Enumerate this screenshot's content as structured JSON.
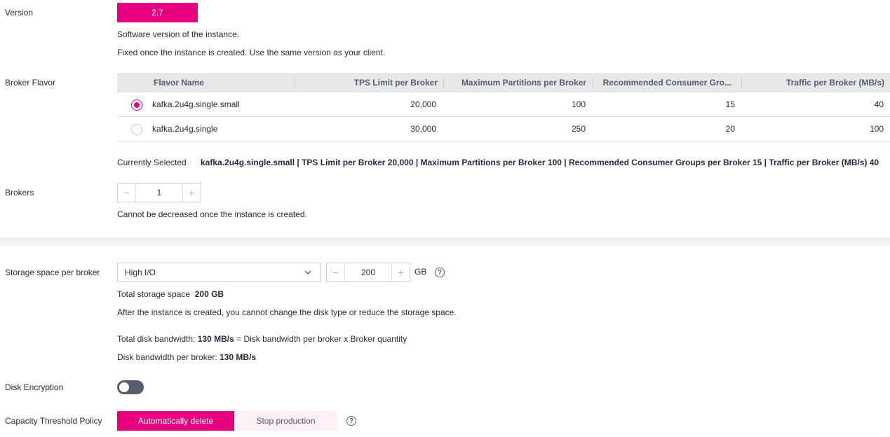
{
  "version": {
    "label": "Version",
    "value": "2.7",
    "hint1": "Software version of the instance.",
    "hint2": "Fixed once the instance is created. Use the same version as your client."
  },
  "flavor": {
    "label": "Broker Flavor",
    "columns": [
      "Flavor Name",
      "TPS Limit per Broker",
      "Maximum Partitions per Broker",
      "Recommended Consumer Gro...",
      "Traffic per Broker (MB/s)"
    ],
    "rows": [
      {
        "name": "kafka.2u4g.single.small",
        "tps": "20,000",
        "partitions": "100",
        "consumer_groups": "15",
        "traffic": "40",
        "selected": true
      },
      {
        "name": "kafka.2u4g.single",
        "tps": "30,000",
        "partitions": "250",
        "consumer_groups": "20",
        "traffic": "100",
        "selected": false
      }
    ],
    "current_label": "Currently Selected",
    "current_value": "kafka.2u4g.single.small | TPS Limit per Broker 20,000 | Maximum Partitions per Broker 100 | Recommended Consumer Groups per Broker 15 | Traffic per Broker (MB/s) 40"
  },
  "brokers": {
    "label": "Brokers",
    "value": "1",
    "minus": "−",
    "plus": "+",
    "hint": "Cannot be decreased once the instance is created."
  },
  "storage": {
    "label": "Storage space per broker",
    "disk_type": "High I/O",
    "size": "200",
    "unit": "GB",
    "minus": "−",
    "plus": "+",
    "help": "?",
    "total_label": "Total storage space",
    "total_value": "200 GB",
    "hint": "After the instance is created, you cannot change the disk type or reduce the storage space.",
    "bw_total_label": "Total disk bandwidth:",
    "bw_total_value": "130 MB/s",
    "bw_total_formula": "= Disk bandwidth per broker x Broker quantity",
    "bw_per_label": "Disk bandwidth per broker:",
    "bw_per_value": "130 MB/s"
  },
  "encryption": {
    "label": "Disk Encryption",
    "enabled": false
  },
  "capacity": {
    "label": "Capacity Threshold Policy",
    "option_on": "Automatically delete",
    "option_off": "Stop production",
    "help": "?"
  },
  "colors": {
    "accent": "#e6007e",
    "toggle_off": "#575d6c",
    "table_header_bg": "#e7e8ea"
  }
}
